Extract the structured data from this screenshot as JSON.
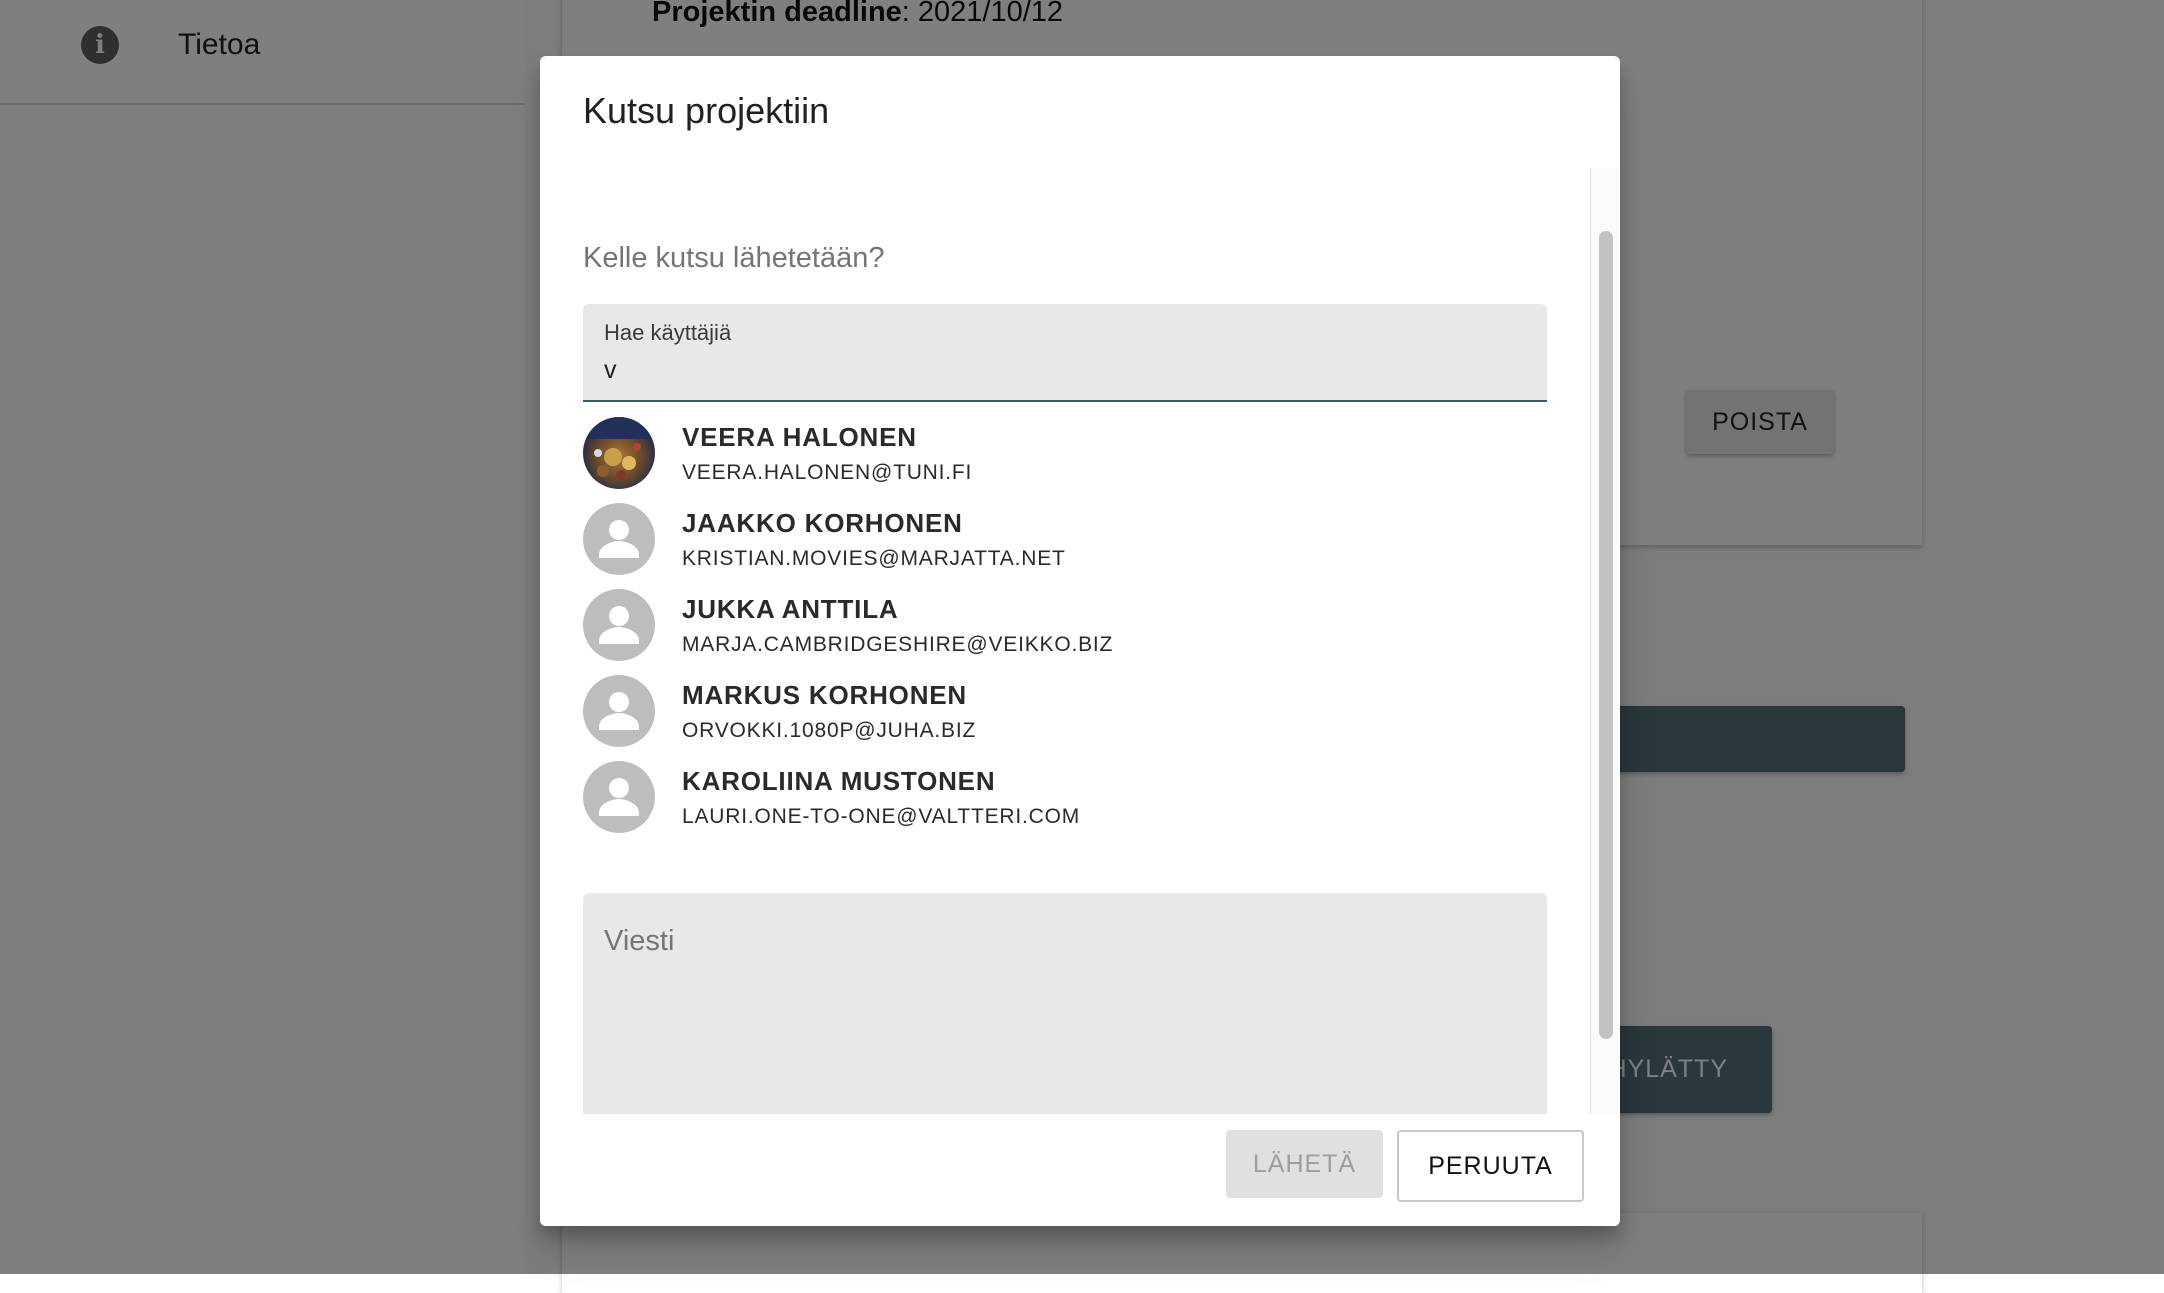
{
  "background": {
    "sidebar": {
      "info_item_label": "Tietoa",
      "info_icon": "info-icon"
    },
    "deadline": {
      "label": "Projektin deadline",
      "value": ": 2021/10/12"
    },
    "delete_button": "POISTA",
    "rejected_button": "HYLÄTTY"
  },
  "dialog": {
    "title": "Kutsu projektiin",
    "subtitle": "Kelle kutsu lähetetään?",
    "search": {
      "label": "Hae käyttäjiä",
      "value": "v"
    },
    "users": [
      {
        "name": "VEERA HALONEN",
        "email": "VEERA.HALONEN@TUNI.FI",
        "avatar": "photo"
      },
      {
        "name": "JAAKKO KORHONEN",
        "email": "KRISTIAN.MOVIES@MARJATTA.NET",
        "avatar": "person-icon"
      },
      {
        "name": "JUKKA ANTTILA",
        "email": "MARJA.CAMBRIDGESHIRE@VEIKKO.BIZ",
        "avatar": "person-icon"
      },
      {
        "name": "MARKUS KORHONEN",
        "email": "ORVOKKI.1080P@JUHA.BIZ",
        "avatar": "person-icon"
      },
      {
        "name": "KAROLIINA MUSTONEN",
        "email": "LAURI.ONE-TO-ONE@VALTTERI.COM",
        "avatar": "person-icon"
      }
    ],
    "message_placeholder": "Viesti",
    "send_button": "LÄHETÄ",
    "cancel_button": "PERUUTA"
  },
  "colors": {
    "backdrop": "rgba(0,0,0,0.5)",
    "accent_dark": "#546e7a",
    "field_background": "#e8e8e8",
    "avatar_gray": "#bdbdbd"
  }
}
